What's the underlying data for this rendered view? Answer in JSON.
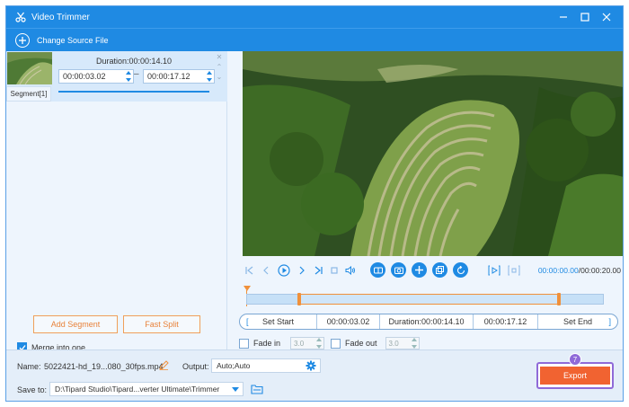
{
  "window": {
    "title": "Video Trimmer"
  },
  "source": {
    "change_label": "Change Source File"
  },
  "segment": {
    "tag": "Segment[1]",
    "duration": "Duration:00:00:14.10",
    "start": "00:00:03.02",
    "end": "00:00:17.12"
  },
  "left_buttons": {
    "add_segment": "Add Segment",
    "fast_split": "Fast Split"
  },
  "merge": {
    "label": "Merge into one",
    "checked": true
  },
  "player": {
    "current_time": "00:00:00.00",
    "total_time": "/00:00:20.00"
  },
  "set_bar": {
    "set_start": "Set Start",
    "start_time": "00:00:03.02",
    "duration": "Duration:00:00:14.10",
    "end_time": "00:00:17.12",
    "set_end": "Set End"
  },
  "fade": {
    "fade_in_label": "Fade in",
    "fade_in_value": "3.0",
    "fade_out_label": "Fade out",
    "fade_out_value": "3.0"
  },
  "output": {
    "name_label": "Name:",
    "name_value": "5022421-hd_19...080_30fps.mp4",
    "output_label": "Output:",
    "output_value": "Auto;Auto",
    "save_label": "Save to:",
    "save_path": "D:\\Tipard Studio\\Tipard...verter Ultimate\\Trimmer",
    "export_label": "Export",
    "step_badge": "7"
  },
  "colors": {
    "accent": "#1f8ae3",
    "export": "#f16331",
    "highlight": "#8f6ad8",
    "trim": "#f0903a"
  }
}
